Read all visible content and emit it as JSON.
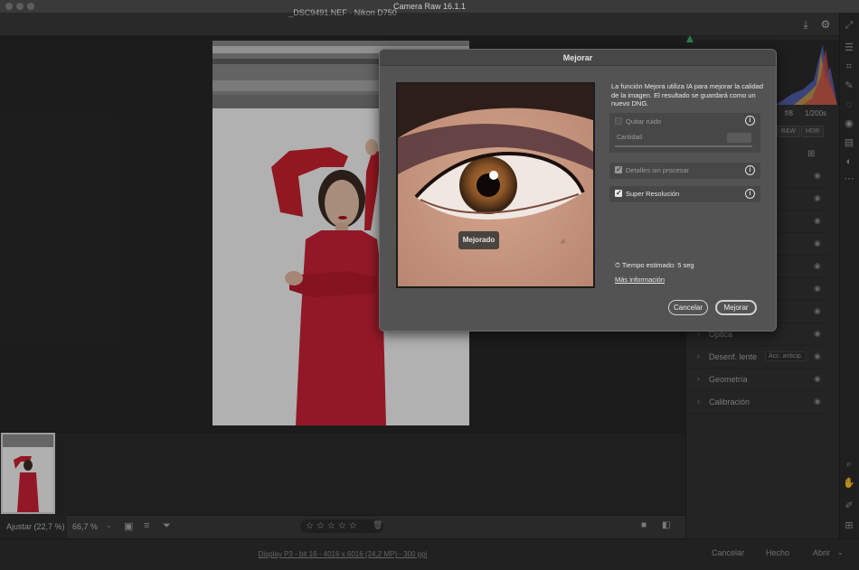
{
  "app": {
    "title": "Camera Raw 16.1.1"
  },
  "file": {
    "name": "_DSC9491.NEF  ·  Nikon D750"
  },
  "toolbar": {
    "zoom_fit": "Ajustar (22,7 %)",
    "zoom_pct": "66,7 %",
    "stars": "☆☆☆☆☆",
    "rating_value": 0
  },
  "status": {
    "display_info": "Display P3 - bit 16 - 4016 x 6016 (24,2 MP) - 300 ppi",
    "cancel": "Cancelar",
    "done": "Hecho",
    "open": "Abrir"
  },
  "panel": {
    "shutter": "1/200s",
    "aperture": "f/8",
    "bw": "B&W",
    "hdr": "HDR",
    "rows": [
      {
        "label": ""
      },
      {
        "label": ""
      },
      {
        "label": ""
      },
      {
        "label": ""
      },
      {
        "label": ""
      },
      {
        "label": ""
      },
      {
        "label": ""
      },
      {
        "label": "Óptica"
      },
      {
        "label": "Desenf. lente",
        "pill": "Acc. anticip."
      },
      {
        "label": "Geometría"
      },
      {
        "label": "Calibración"
      }
    ]
  },
  "dialog": {
    "title": "Mejorar",
    "description": "La función Mejora utiliza IA para mejorar la calidad de la imagen. El resultado se guardará como un nuevo DNG.",
    "badge": "Mejorado",
    "options": {
      "denoise_label": "Quitar ruido",
      "denoise_checked": false,
      "amount_label": "Cantidad",
      "raw_details_label": "Detalles sin procesar",
      "raw_details_checked": true,
      "super_res_label": "Super Resolución",
      "super_res_checked": true
    },
    "estimated_time": "Tiempo estimado: 5 seg",
    "more_info": "Más información",
    "cancel": "Cancelar",
    "confirm": "Mejorar"
  },
  "colors": {
    "dress": "#cc2236",
    "dialog_bg": "#535353",
    "panel_bg": "#323232",
    "accent_green": "#3fae5b"
  }
}
